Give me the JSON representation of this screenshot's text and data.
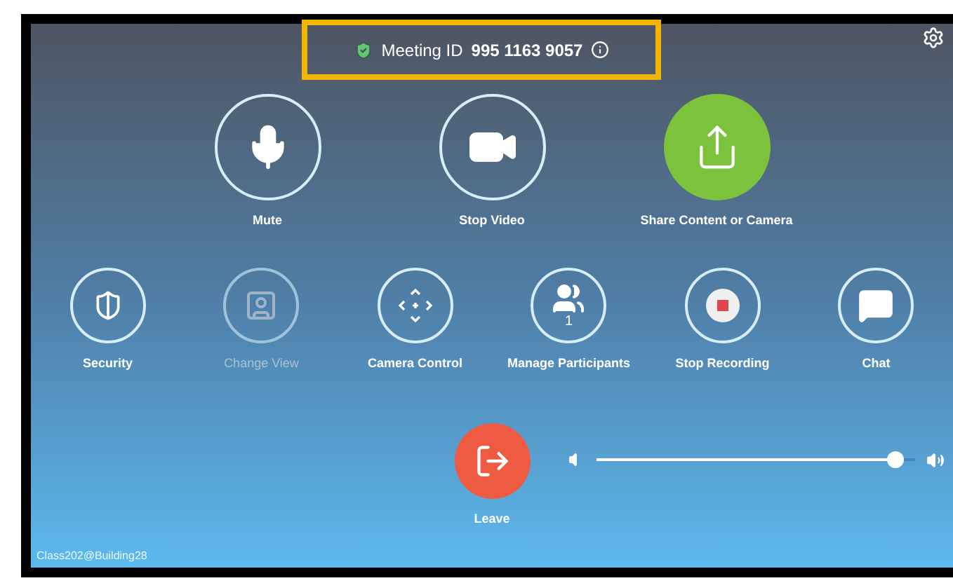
{
  "meeting": {
    "label": "Meeting ID",
    "id": "995 1163 9057",
    "secure": true,
    "highlighted": true
  },
  "primary_actions": [
    {
      "kind": "mic",
      "label": "Mute",
      "selected": false
    },
    {
      "kind": "video",
      "label": "Stop Video",
      "selected": false
    },
    {
      "kind": "share",
      "label": "Share Content or Camera",
      "selected": true
    }
  ],
  "secondary_actions": [
    {
      "kind": "security",
      "label": "Security",
      "disabled": false
    },
    {
      "kind": "view",
      "label": "Change View",
      "disabled": true
    },
    {
      "kind": "camera",
      "label": "Camera Control",
      "disabled": false
    },
    {
      "kind": "participants",
      "label": "Manage Participants",
      "disabled": false,
      "count": "1"
    },
    {
      "kind": "record",
      "label": "Stop Recording",
      "disabled": false
    },
    {
      "kind": "chat",
      "label": "Chat",
      "disabled": false
    }
  ],
  "leave": {
    "label": "Leave"
  },
  "volume": {
    "level": 0.94
  },
  "room_name": "Class202@Building28"
}
